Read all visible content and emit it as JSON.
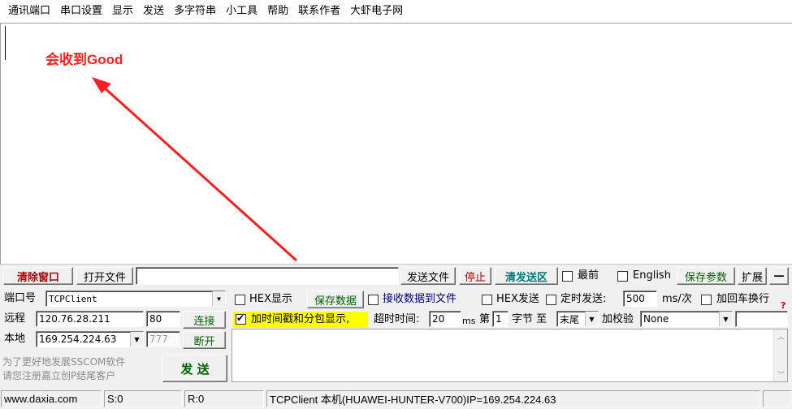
{
  "menu": [
    "通讯端口",
    "串口设置",
    "显示",
    "发送",
    "多字符串",
    "小工具",
    "帮助",
    "联系作者",
    "大虾电子网"
  ],
  "receive": {
    "annotation": "会收到Good"
  },
  "toolbar": {
    "clear_window": "清除窗口",
    "open_file": "打开文件",
    "file_path": "",
    "send_file": "发送文件",
    "stop": "停止",
    "clear_send_area": "清发送区",
    "topmost": "最前",
    "english": "English",
    "save_params": "保存参数",
    "expand": "扩展",
    "collapse": "—"
  },
  "connection": {
    "port_label": "端口号",
    "port_value": "TCPClient",
    "remote_label": "远程",
    "remote_ip": "120.76.28.211",
    "remote_port": "80",
    "connect": "连接",
    "local_label": "本地",
    "local_ip": "169.254.224.63",
    "local_port": "777",
    "disconnect": "断开",
    "promo_line1": "为了更好地发展SSCOM软件",
    "promo_line2": "请您注册嘉立创P结尾客户",
    "send": "发  送"
  },
  "options": {
    "hex_display": "HEX显示",
    "save_data": "保存数据",
    "receive_to_file": "接收数据到文件",
    "hex_send": "HEX发送",
    "timed_send": "定时发送:",
    "interval_value": "500",
    "interval_unit": "ms/次",
    "append_crlf": "加回车换行",
    "timestamp_packet": "加时间戳和分包显示,",
    "timeout_label": "超时时间:",
    "timeout_value": "20",
    "timeout_unit": "ms",
    "byte_prefix": "第",
    "byte_value": "1",
    "byte_suffix": "字节 至",
    "end_value": "末尾",
    "checksum_label": "加校验",
    "checksum_value": "None",
    "help_mark": "?"
  },
  "send_text": "",
  "status": {
    "site": "www.daxia.com",
    "sent": "S:0",
    "received": "R:0",
    "message": "TCPClient 本机(HUAWEI-HUNTER-V700)IP=169.254.224.63"
  },
  "colors": {
    "annotation": "#ff1f1f",
    "highlight": "#ffff00",
    "clear_button": "#b40000",
    "green_button": "#006400"
  },
  "icons": [
    "dropdown-arrow-icon",
    "scroll-up-icon",
    "scroll-down-icon"
  ]
}
